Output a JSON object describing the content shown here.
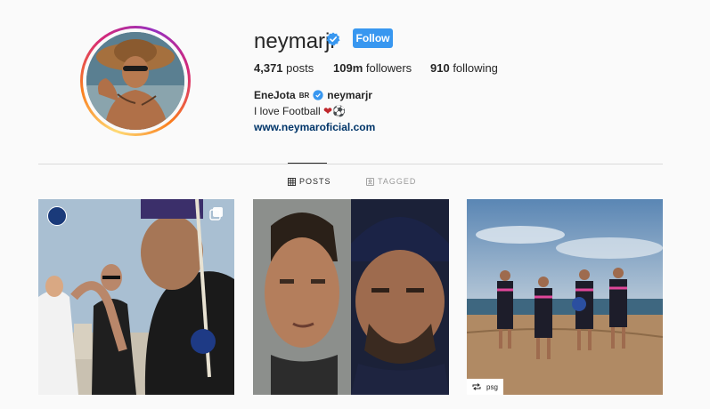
{
  "profile": {
    "username": "neymarjr",
    "follow_label": "Follow",
    "stats": {
      "posts_count": "4,371",
      "posts_label": " posts",
      "followers_count": "109m",
      "followers_label": " followers",
      "following_count": "910",
      "following_label": " following"
    },
    "bio": {
      "name": "EneJota",
      "flag": "BR",
      "handle": "neymarjr",
      "text": "I love Football ",
      "heart": "❤",
      "ball": "⚽",
      "link": "www.neymaroficial.com"
    }
  },
  "tabs": [
    {
      "label": "POSTS",
      "active": true,
      "icon": "grid-icon"
    },
    {
      "label": "TAGGED",
      "active": false,
      "icon": "tag-icon"
    }
  ],
  "posts": [
    {
      "id": "post-1",
      "type": "carousel",
      "badge": "psg-logo"
    },
    {
      "id": "post-2",
      "type": "image"
    },
    {
      "id": "post-3",
      "type": "image",
      "tag_label": "psg"
    }
  ],
  "colors": {
    "accent": "#3897f0",
    "link": "#003569",
    "text": "#262626",
    "muted": "#999999",
    "divider": "#dbdbdb",
    "background": "#fafafa"
  }
}
